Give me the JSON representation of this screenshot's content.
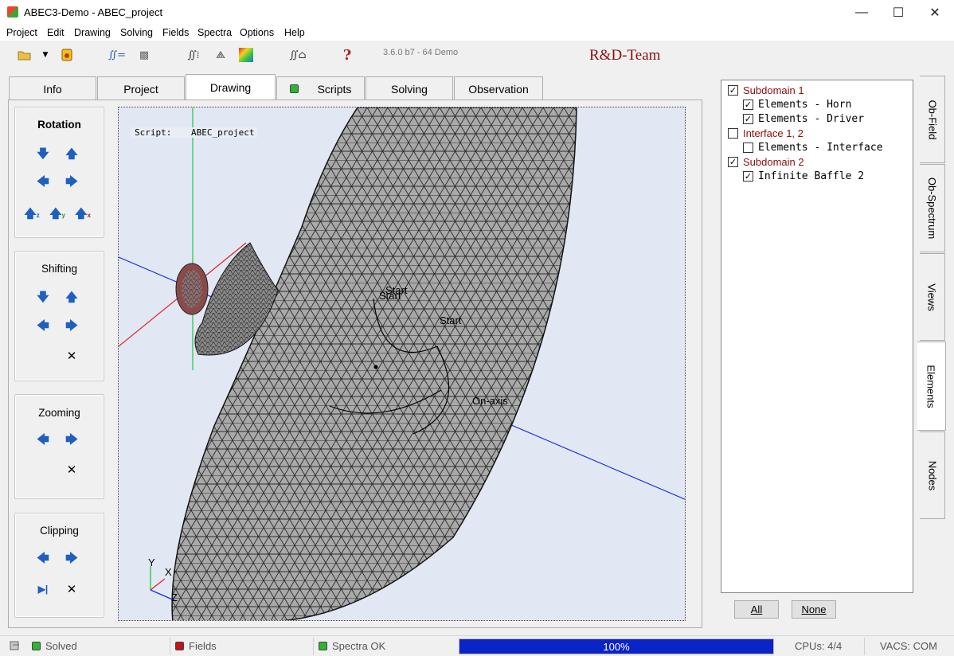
{
  "window": {
    "title": "ABEC3-Demo - ABEC_project",
    "minimize_glyph": "—",
    "maximize_glyph": "☐",
    "close_glyph": "✕"
  },
  "menu": [
    {
      "label": "Project"
    },
    {
      "label": "Edit"
    },
    {
      "label": "Drawing"
    },
    {
      "label": "Solving"
    },
    {
      "label": "Fields"
    },
    {
      "label": "Spectra"
    },
    {
      "label": "Options"
    },
    {
      "label": "Help"
    }
  ],
  "toolbar": {
    "version": "3.6.0 b7 - 64 Demo",
    "team": "R&D-Team",
    "icons": [
      "open-folder-icon",
      "dropdown-arrow-icon",
      "save-icon",
      "solve-integral-icon",
      "mesh-icon",
      "spectra-integral-icon",
      "wireframe-icon",
      "colormap-icon",
      "observation-integral-icon",
      "help-icon"
    ],
    "solve_glyph": "∬=",
    "spectra_glyph": "∬⁞",
    "obs_glyph": "∬⌂",
    "help_glyph": "?",
    "mesh_glyph": "▩",
    "wire_glyph": "⟁"
  },
  "tabs": [
    {
      "label": "Info"
    },
    {
      "label": "Project"
    },
    {
      "label": "Drawing",
      "active": true
    },
    {
      "label": "Scripts"
    },
    {
      "label": "Solving"
    },
    {
      "label": "Observation"
    }
  ],
  "controls": {
    "rotation": {
      "caption": "Rotation",
      "z": "z",
      "y": "y",
      "x": "x"
    },
    "shifting": {
      "caption": "Shifting"
    },
    "zooming": {
      "caption": "Zooming"
    },
    "clipping": {
      "caption": "Clipping"
    }
  },
  "viewport": {
    "script_label": "Script:",
    "script_value": "ABEC_project",
    "annotations": [
      "Start",
      "Start",
      "Start",
      "On-axis"
    ],
    "axes": {
      "y": "Y",
      "x": "X",
      "z": "Z"
    }
  },
  "tree": [
    {
      "label": "Subdomain 1",
      "checked": true,
      "level": 0,
      "color": "#8b0d0d"
    },
    {
      "label": "Elements - Horn",
      "checked": true,
      "level": 1,
      "color": "#000000"
    },
    {
      "label": "Elements - Driver",
      "checked": true,
      "level": 1,
      "color": "#000000"
    },
    {
      "label": "Interface 1, 2",
      "checked": false,
      "level": 0,
      "color": "#8b0d0d"
    },
    {
      "label": "Elements - Interface",
      "checked": false,
      "level": 1,
      "color": "#000000"
    },
    {
      "label": "Subdomain 2",
      "checked": true,
      "level": 0,
      "color": "#8b0d0d"
    },
    {
      "label": "Infinite Baffle 2",
      "checked": true,
      "level": 1,
      "color": "#000000"
    }
  ],
  "side_tabs": [
    {
      "label": "Ob-Field"
    },
    {
      "label": "Ob-Spectrum"
    },
    {
      "label": "Views"
    },
    {
      "label": "Elements",
      "active": true
    },
    {
      "label": "Nodes"
    }
  ],
  "buttons": {
    "all": "All",
    "none": "None"
  },
  "status": {
    "solved": "Solved",
    "fields": "Fields",
    "spectra": "Spectra OK",
    "progress_text": "100%",
    "progress": 1.0,
    "cpus": "CPUs: 4/4",
    "vacs": "VACS: COM",
    "colors": {
      "ok": "#2fb52f",
      "bad": "#c0141a",
      "progress": "#0a24c8"
    }
  }
}
